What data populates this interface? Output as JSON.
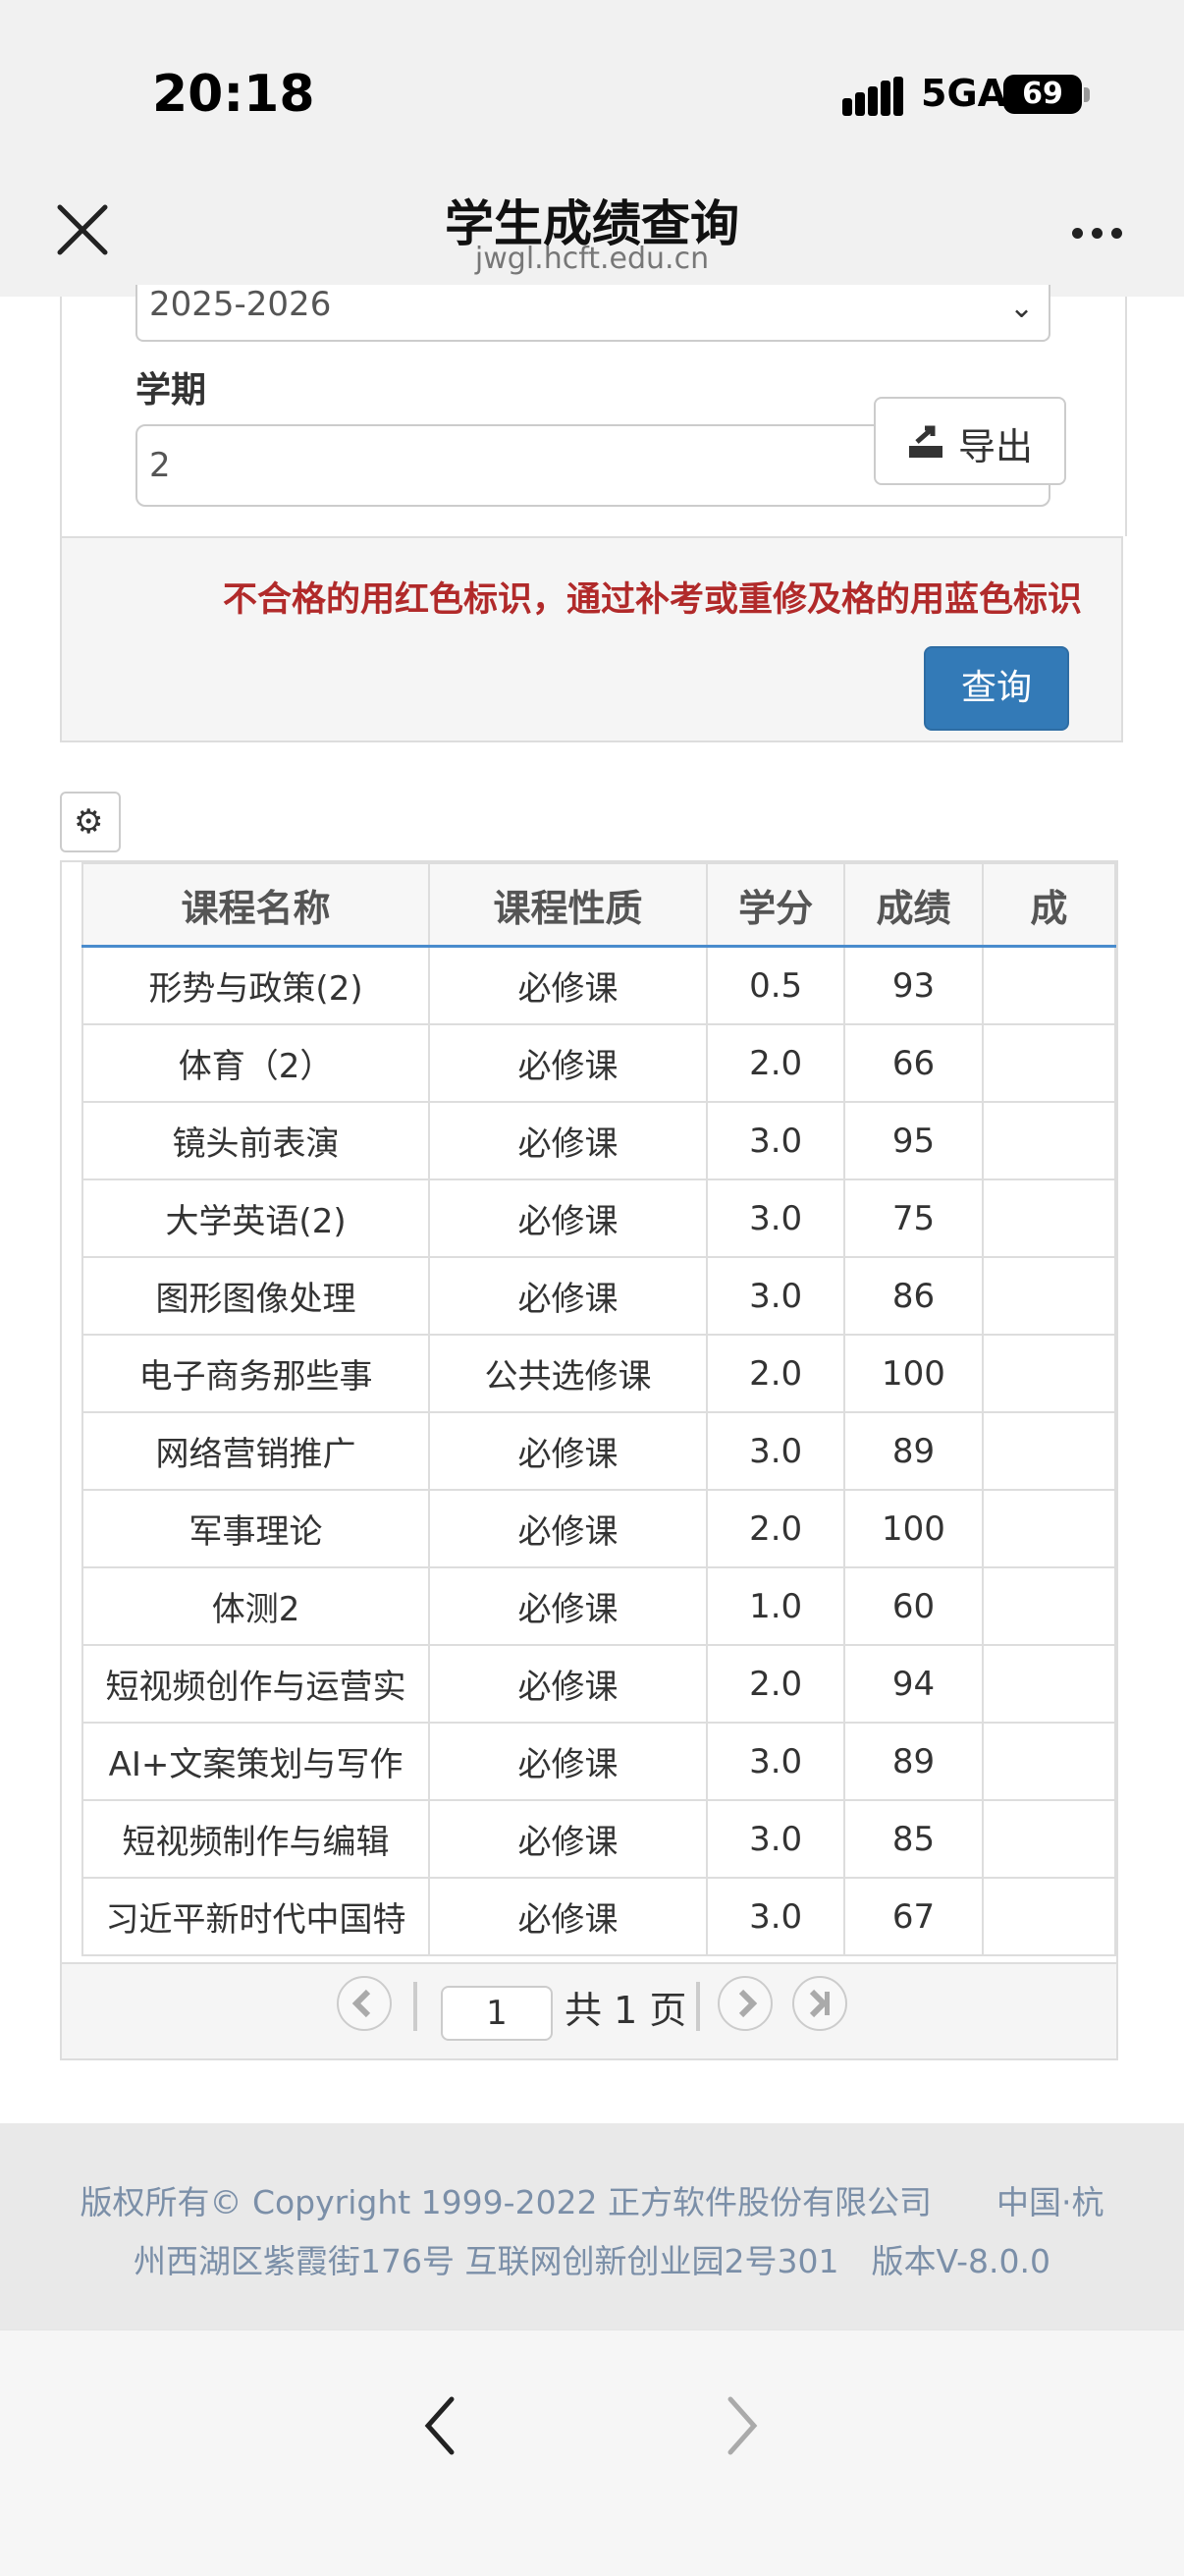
{
  "status_bar": {
    "time": "20:18",
    "network": "5GA",
    "battery": "69"
  },
  "nav": {
    "title": "学生成绩查询",
    "url": "jwgl.hcft.edu.cn"
  },
  "form": {
    "year_value": "2025-2026",
    "term_label": "学期",
    "term_value": "2",
    "export_label": "导出",
    "notice": "不合格的用红色标识，通过补考或重修及格的用蓝色标识",
    "query_label": "查询"
  },
  "table": {
    "headers": [
      "课程名称",
      "课程性质",
      "学分",
      "成绩",
      "成"
    ],
    "rows": [
      [
        "形势与政策(2)",
        "必修课",
        "0.5",
        "93"
      ],
      [
        "体育（2）",
        "必修课",
        "2.0",
        "66"
      ],
      [
        "镜头前表演",
        "必修课",
        "3.0",
        "95"
      ],
      [
        "大学英语(2)",
        "必修课",
        "3.0",
        "75"
      ],
      [
        "图形图像处理",
        "必修课",
        "3.0",
        "86"
      ],
      [
        "电子商务那些事",
        "公共选修课",
        "2.0",
        "100"
      ],
      [
        "网络营销推广",
        "必修课",
        "3.0",
        "89"
      ],
      [
        "军事理论",
        "必修课",
        "2.0",
        "100"
      ],
      [
        "体测2",
        "必修课",
        "1.0",
        "60"
      ],
      [
        "短视频创作与运营实",
        "必修课",
        "2.0",
        "94"
      ],
      [
        "AI+文案策划与写作",
        "必修课",
        "3.0",
        "89"
      ],
      [
        "短视频制作与编辑",
        "必修课",
        "3.0",
        "85"
      ],
      [
        "习近平新时代中国特",
        "必修课",
        "3.0",
        "67"
      ]
    ]
  },
  "pager": {
    "current_page": "1",
    "total_text": "共 1 页"
  },
  "footer": {
    "line1": "版权所有© Copyright 1999-2022 正方软件股份有限公司　　中国·杭",
    "line2": "州西湖区紫霞街176号 互联网创新创业园2号301　版本V-8.0.0"
  },
  "icons": {
    "close": "close-icon",
    "more": "more-icon",
    "export": "export-icon",
    "gear": "gear-icon",
    "prev": "prev-page-icon",
    "next": "next-page-icon",
    "last": "last-page-icon",
    "back": "browser-back-icon",
    "forward": "browser-forward-icon"
  },
  "colors": {
    "primary": "#337ab7",
    "notice": "#b12a2a",
    "footer_text": "#7b8fa8"
  }
}
